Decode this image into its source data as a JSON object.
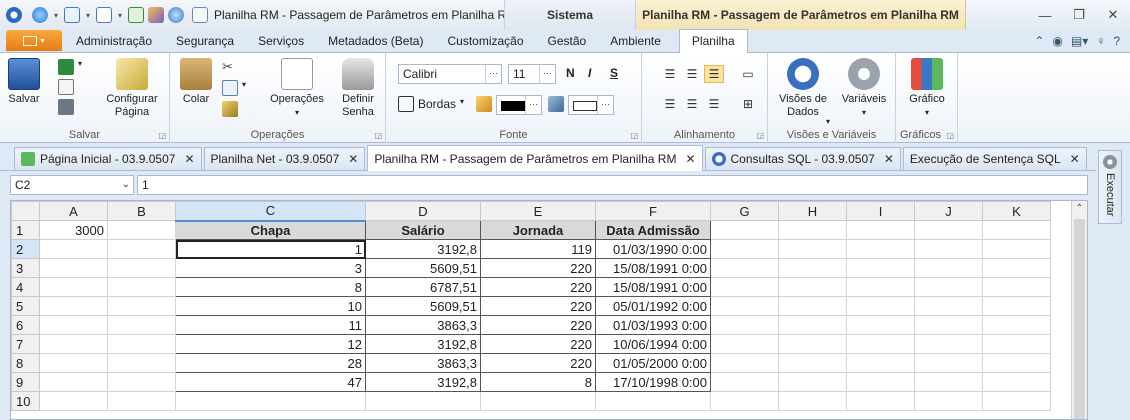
{
  "titlebar": {
    "document_title": "Planilha RM - Passagem de Parâmetros em Planilha RM -",
    "context_sistema": "Sistema",
    "context_planilha": "Planilha RM - Passagem de Parâmetros em Planilha RM"
  },
  "ribbon_tabs": [
    "Administração",
    "Segurança",
    "Serviços",
    "Metadados (Beta)",
    "Customização",
    "Gestão",
    "Ambiente",
    "Planilha"
  ],
  "ribbon": {
    "salvar": {
      "btn_salvar": "Salvar",
      "btn_configurar": "Configurar Página",
      "label": "Salvar"
    },
    "operacoes": {
      "btn_colar": "Colar",
      "btn_operacoes": "Operações",
      "btn_definir": "Definir Senha",
      "label": "Operações"
    },
    "fonte": {
      "font_name": "Calibri",
      "font_size": "11",
      "bold": "N",
      "italic": "I",
      "strike": "S",
      "bordas": "Bordas",
      "label": "Fonte"
    },
    "alinhamento": {
      "label": "Alinhamento"
    },
    "visoes": {
      "btn_visoes": "Visões de Dados",
      "btn_variaveis": "Variáveis",
      "label": "Visões e Variáveis"
    },
    "graficos": {
      "btn_grafico": "Gráfico",
      "label": "Gráficos"
    }
  },
  "doc_tabs": [
    "Página Inicial - 03.9.0507",
    "Planilha Net - 03.9.0507",
    "Planilha RM - Passagem de Parâmetros em Planilha RM",
    "Consultas SQL - 03.9.0507",
    "Execução de Sentença SQL"
  ],
  "side_panel": {
    "label": "Executar"
  },
  "formula_bar": {
    "name_box": "C2",
    "value": "1"
  },
  "sheet": {
    "columns": [
      "A",
      "B",
      "C",
      "D",
      "E",
      "F",
      "G",
      "H",
      "I",
      "J",
      "K"
    ],
    "rows": [
      "1",
      "2",
      "3",
      "4",
      "5",
      "6",
      "7",
      "8",
      "9",
      "10"
    ],
    "a1": "3000",
    "headers": [
      "Chapa",
      "Salário",
      "Jornada",
      "Data Admissão"
    ],
    "data": [
      [
        "1",
        "3192,8",
        "119",
        "01/03/1990 0:00"
      ],
      [
        "3",
        "5609,51",
        "220",
        "15/08/1991 0:00"
      ],
      [
        "8",
        "6787,51",
        "220",
        "15/08/1991 0:00"
      ],
      [
        "10",
        "5609,51",
        "220",
        "05/01/1992 0:00"
      ],
      [
        "11",
        "3863,3",
        "220",
        "01/03/1993 0:00"
      ],
      [
        "12",
        "3192,8",
        "220",
        "10/06/1994 0:00"
      ],
      [
        "28",
        "3863,3",
        "220",
        "01/05/2000 0:00"
      ],
      [
        "47",
        "3192,8",
        "8",
        "17/10/1998 0:00"
      ]
    ]
  }
}
